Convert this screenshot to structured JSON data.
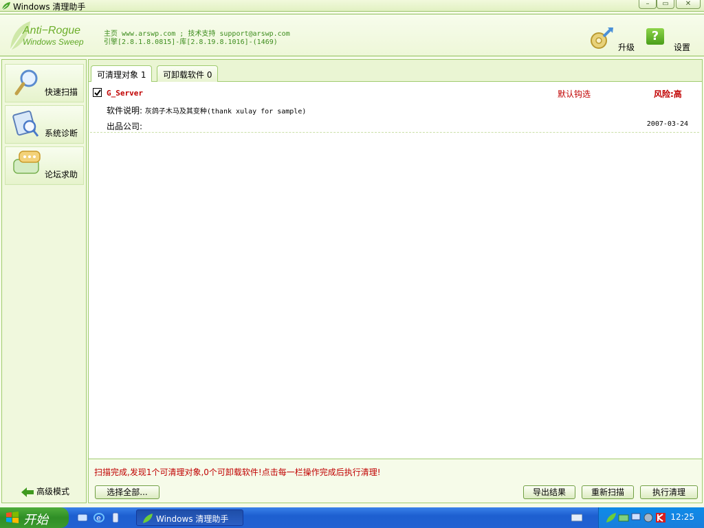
{
  "window": {
    "title": "Windows 清理助手",
    "buttons": {
      "minimize": "–",
      "restore": "▭",
      "close": "✕"
    }
  },
  "header": {
    "logo_line1": "Anti−Rogue",
    "logo_line2": "Windows Sweep",
    "info_line1": "主页 www.arswp.com ; 技术支持 support@arswp.com",
    "info_line2": "引擎[2.8.1.8.0815]-库[2.8.19.8.1016]-(1469)",
    "upgrade_label": "升级",
    "settings_label": "设置",
    "help_glyph": "?"
  },
  "sidebar": {
    "items": [
      {
        "label": "快速扫描",
        "icon": "magnifier-icon"
      },
      {
        "label": "系统诊断",
        "icon": "diagnosis-icon"
      },
      {
        "label": "论坛求助",
        "icon": "chat-bubble-icon"
      }
    ],
    "advanced_mode": "高级模式"
  },
  "tabs": [
    {
      "label": "可清理对象 1",
      "active": true
    },
    {
      "label": "可卸载软件 0",
      "active": false
    }
  ],
  "items": [
    {
      "checked": true,
      "name": "G_Server",
      "default_check": "默认钩选",
      "risk": "风险:高",
      "desc_label": "软件说明:",
      "desc_value": "灰鸽子木马及其变种(thank xulay for sample)",
      "company_label": "出品公司:",
      "date": "2007-03-24"
    }
  ],
  "status": {
    "message": "扫描完成,发现1个可清理对象,0个可卸载软件!点击每一栏操作完成后执行清理!"
  },
  "buttons": {
    "select_all": "选择全部...",
    "export": "导出结果",
    "rescan": "重新扫描",
    "execute": "执行清理"
  },
  "taskbar": {
    "start_label": "开始",
    "task_label": "Windows 清理助手",
    "clock": "12:25"
  },
  "colors": {
    "accent_green": "#6cae2a",
    "alert_red": "#c00000",
    "taskbar_blue": "#2261d2"
  }
}
